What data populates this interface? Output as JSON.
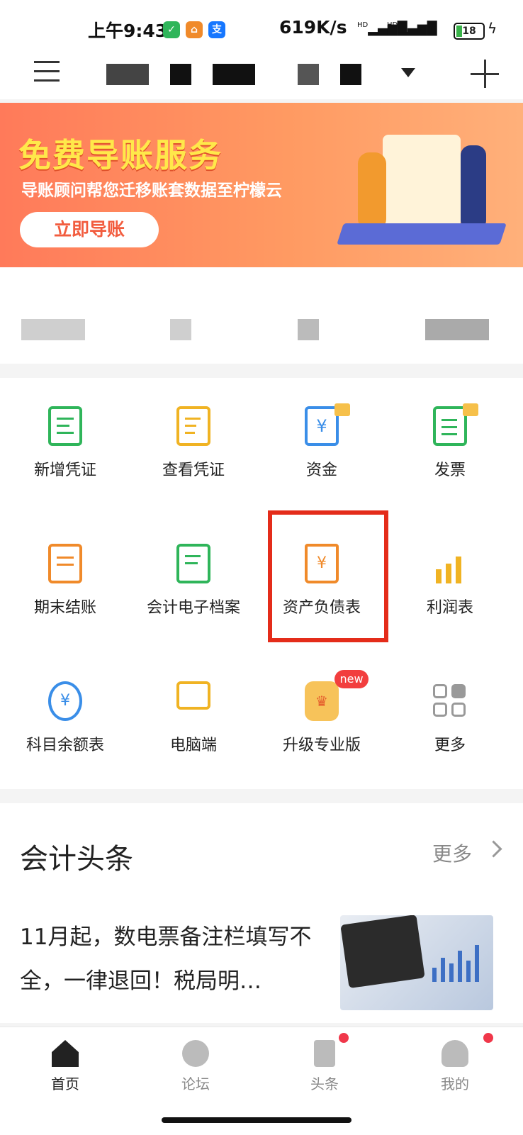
{
  "status_bar": {
    "time": "上午9:43",
    "network_speed": "619K/s",
    "signal_1": "HD",
    "signal_2": "HD",
    "battery": "18"
  },
  "header": {
    "menu_icon": "hamburger-icon",
    "add_icon": "plus-icon",
    "dropdown_icon": "caret-down-icon"
  },
  "banner": {
    "title": "免费导账服务",
    "subtitle": "导账顾问帮您迁移账套数据至柠檬云",
    "cta": "立即导账"
  },
  "grid": {
    "items": [
      {
        "label": "新增凭证"
      },
      {
        "label": "查看凭证"
      },
      {
        "label": "资金"
      },
      {
        "label": "发票"
      },
      {
        "label": "期末结账"
      },
      {
        "label": "会计电子档案"
      },
      {
        "label": "资产负债表"
      },
      {
        "label": "利润表"
      },
      {
        "label": "科目余额表"
      },
      {
        "label": "电脑端"
      },
      {
        "label": "升级专业版"
      },
      {
        "label": "更多"
      }
    ],
    "new_badge": "new"
  },
  "news": {
    "title": "会计头条",
    "more": "更多",
    "article_title": "11月起，数电票备注栏填写不全，一律退回！税局明…"
  },
  "bottom_nav": {
    "items": [
      {
        "label": "首页"
      },
      {
        "label": "论坛"
      },
      {
        "label": "头条"
      },
      {
        "label": "我的"
      }
    ]
  },
  "colors": {
    "accent_green": "#2fb55a",
    "accent_yellow": "#f0b323",
    "accent_blue": "#3a8ee8",
    "accent_orange": "#f08a2a",
    "highlight_red": "#e42c1a",
    "banner_start": "#ff7a5a"
  }
}
